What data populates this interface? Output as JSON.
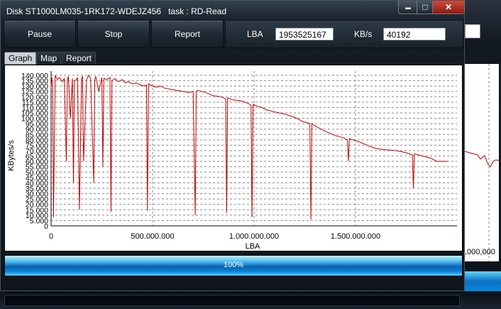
{
  "window": {
    "title": "Disk ST1000LM035-1RK172-WDEJZ456   task : RD-Read",
    "controls": {
      "minimize": "▬",
      "maximize": "□",
      "close": "✕"
    }
  },
  "toolbar": {
    "pause_label": "Pause",
    "stop_label": "Stop",
    "report_label": "Report",
    "lba_label": "LBA",
    "lba_value": "1953525167",
    "speed_label": "KB/s",
    "speed_value": "40192"
  },
  "tabs": [
    {
      "label": "Graph",
      "active": true
    },
    {
      "label": "Map",
      "active": false
    },
    {
      "label": "Report",
      "active": false
    }
  ],
  "chart_data": {
    "type": "line",
    "xlabel": "LBA",
    "ylabel": "KBytes/s",
    "xlim": [
      0,
      2000000000
    ],
    "ylim": [
      0,
      140
    ],
    "x_ticks": [
      "0",
      "500.000.000",
      "1.000.000.000",
      "1.500.000.000"
    ],
    "y_ticks": [
      "0",
      "5.000",
      "10.000",
      "15.000",
      "20.000",
      "25.000",
      "30.000",
      "35.000",
      "40.000",
      "45.000",
      "50.000",
      "55.000",
      "60.000",
      "65.000",
      "70.000",
      "75.000",
      "80.000",
      "85.000",
      "90.000",
      "95.000",
      "100.000",
      "105.000",
      "110.000",
      "115.000",
      "120.000",
      "125.000",
      "130.000",
      "135.000",
      "140.000"
    ],
    "grid": true,
    "line_color": "#c00000",
    "series": [
      {
        "x": [
          0,
          3000000,
          8000000,
          12000000,
          20000000,
          30000000,
          42000000,
          55000000,
          65000000,
          75000000,
          80000000,
          85000000,
          95000000,
          105000000,
          110000000,
          115000000,
          125000000,
          130000000,
          140000000,
          150000000,
          155000000,
          160000000,
          175000000,
          185000000,
          195000000,
          210000000,
          215000000,
          220000000,
          235000000,
          250000000,
          255000000,
          260000000,
          275000000,
          290000000,
          295000000,
          300000000,
          315000000,
          330000000,
          350000000,
          365000000,
          380000000,
          400000000,
          420000000,
          440000000,
          460000000,
          470000000,
          475000000,
          480000000,
          500000000,
          520000000,
          540000000,
          560000000,
          590000000,
          620000000,
          650000000,
          680000000,
          700000000,
          710000000,
          715000000,
          720000000,
          760000000,
          800000000,
          840000000,
          860000000,
          865000000,
          870000000,
          900000000,
          940000000,
          970000000,
          985000000,
          990000000,
          995000000,
          1020000000,
          1040000000,
          1060000000,
          1100000000,
          1150000000,
          1200000000,
          1240000000,
          1260000000,
          1275000000,
          1280000000,
          1285000000,
          1300000000,
          1350000000,
          1400000000,
          1440000000,
          1460000000,
          1465000000,
          1470000000,
          1520000000,
          1570000000,
          1600000000,
          1640000000,
          1700000000,
          1750000000,
          1780000000,
          1785000000,
          1790000000,
          1830000000,
          1870000000,
          1900000000,
          1953525167
        ],
        "values": [
          128,
          138,
          130,
          8,
          140,
          136,
          138,
          134,
          137,
          60,
          136,
          139,
          100,
          137,
          40,
          135,
          136,
          138,
          15,
          137,
          139,
          60,
          136,
          140,
          137,
          40,
          136,
          139,
          125,
          138,
          55,
          137,
          136,
          138,
          13,
          135,
          137,
          134,
          136,
          133,
          134,
          132,
          133,
          131,
          130,
          131,
          14,
          132,
          130,
          129,
          130,
          128,
          127,
          126,
          125,
          124,
          125,
          10,
          124,
          126,
          124,
          121,
          120,
          118,
          12,
          119,
          117,
          116,
          114,
          112,
          8,
          113,
          111,
          110,
          108,
          106,
          104,
          101,
          97,
          96,
          95,
          6,
          95,
          93,
          88,
          84,
          82,
          80,
          60,
          81,
          78,
          74,
          72,
          71,
          70,
          68,
          66,
          35,
          67,
          65,
          63,
          60,
          60
        ]
      }
    ]
  },
  "progress": {
    "value": 1.0,
    "label": "100%"
  },
  "background_window": {
    "tick_label": ",000,000"
  }
}
